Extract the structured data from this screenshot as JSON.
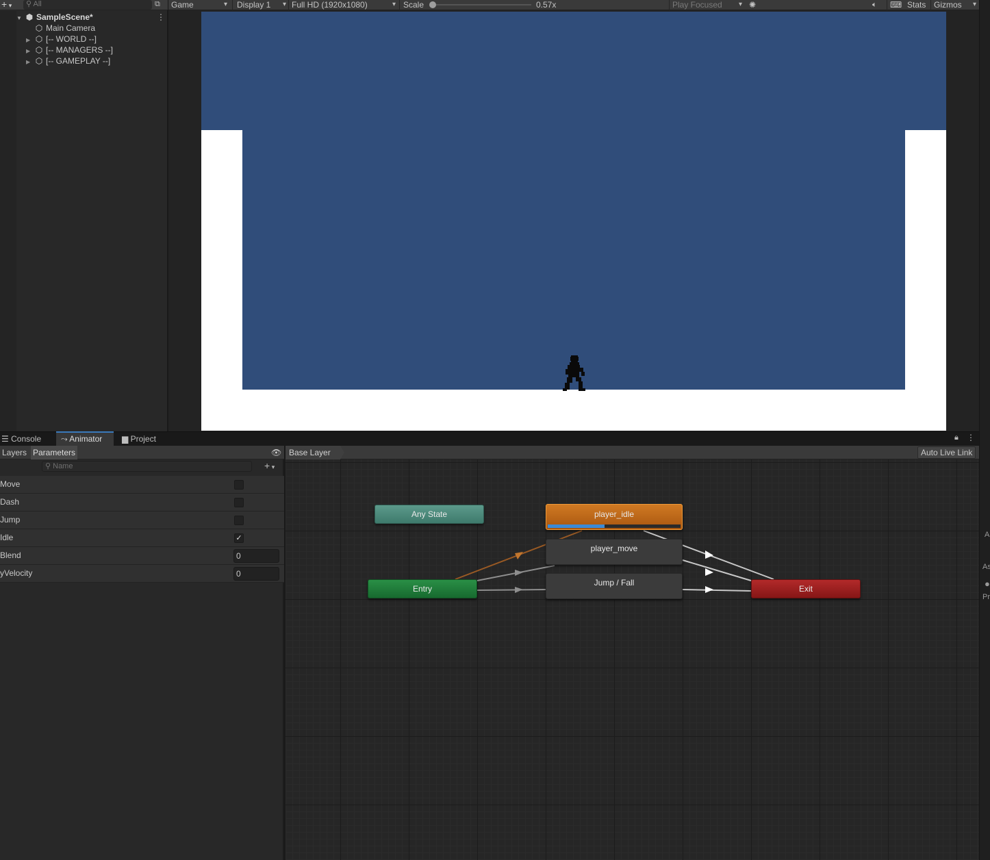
{
  "hierarchy": {
    "search_placeholder": "All",
    "scene_name": "SampleScene*",
    "items": [
      {
        "label": "Main Camera",
        "icon": "gameobject-icon",
        "expandable": false
      },
      {
        "label": "[-- WORLD --]",
        "icon": "gameobject-icon",
        "expandable": true
      },
      {
        "label": "[-- MANAGERS --]",
        "icon": "gameobject-icon",
        "expandable": true
      },
      {
        "label": "[-- GAMEPLAY --]",
        "icon": "gameobject-icon",
        "expandable": true
      }
    ]
  },
  "game_toolbar": {
    "view": "Game",
    "display": "Display 1",
    "resolution": "Full HD (1920x1080)",
    "scale_label": "Scale",
    "scale_value": "0.57x",
    "play_mode": "Play Focused",
    "stats": "Stats",
    "gizmos": "Gizmos"
  },
  "game_view": {
    "sky_color": "#304d7a",
    "ground_color": "#ffffff"
  },
  "bottom_tabs": [
    {
      "label": "Console",
      "icon": "console-icon",
      "active": false
    },
    {
      "label": "Animator",
      "icon": "animator-icon",
      "active": true
    },
    {
      "label": "Project",
      "icon": "folder-icon",
      "active": false
    }
  ],
  "animator": {
    "left_tabs": {
      "layers": "Layers",
      "parameters": "Parameters"
    },
    "search_placeholder": "Name",
    "parameters": [
      {
        "name": "Move",
        "type": "bool",
        "value": false
      },
      {
        "name": "Dash",
        "type": "bool",
        "value": false
      },
      {
        "name": "Jump",
        "type": "bool",
        "value": false
      },
      {
        "name": "Idle",
        "type": "bool",
        "value": true
      },
      {
        "name": "Blend",
        "type": "float",
        "value": "0"
      },
      {
        "name": "yVelocity",
        "type": "float",
        "value": "0"
      }
    ],
    "breadcrumb": "Base Layer",
    "auto_live_link": "Auto Live Link",
    "states": {
      "any_state": "Any State",
      "entry": "Entry",
      "exit": "Exit",
      "player_idle": "player_idle",
      "player_move": "player_move",
      "jump_fall": "Jump / Fall"
    },
    "active_state_progress": 0.43,
    "colors": {
      "any_state": "#4f8c7e",
      "entry": "#21803c",
      "exit": "#a02020",
      "active": "#c06a1b",
      "progress": "#3c8ad6"
    }
  }
}
